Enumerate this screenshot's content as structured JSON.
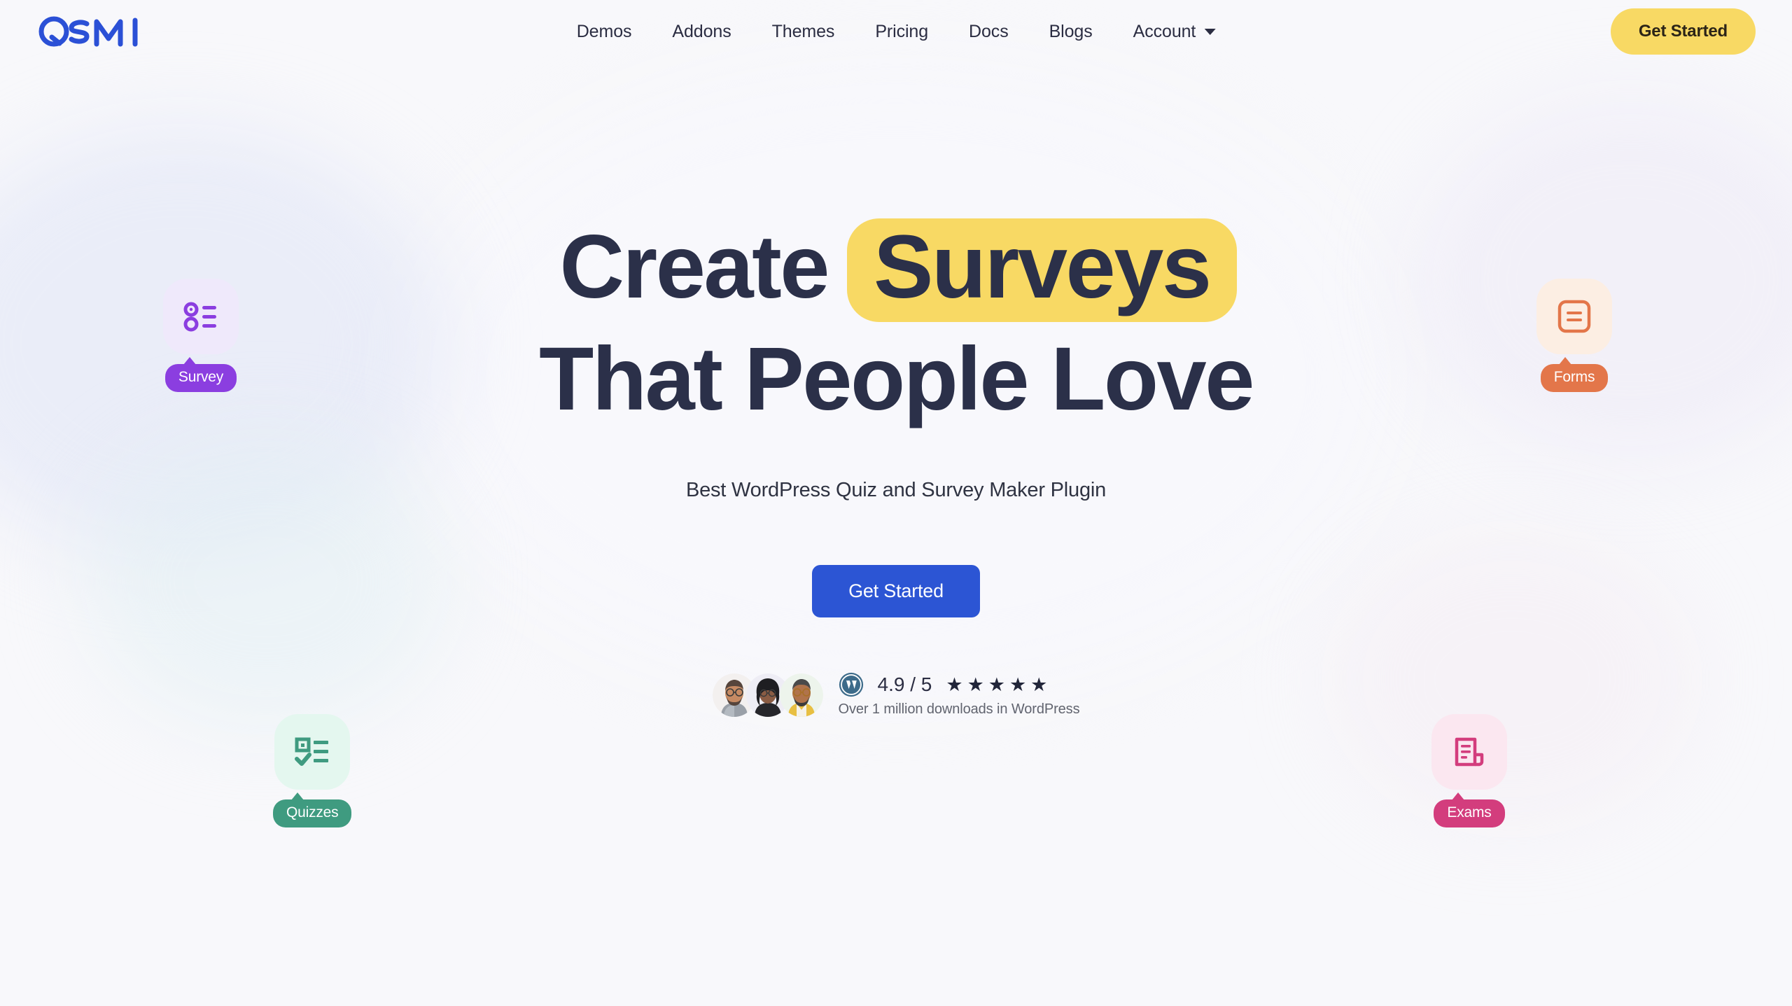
{
  "brand": {
    "name": "QSM",
    "logo_color": "#2b50d6"
  },
  "header": {
    "nav": [
      {
        "label": "Demos",
        "icon": null
      },
      {
        "label": "Addons",
        "icon": null
      },
      {
        "label": "Themes",
        "icon": null
      },
      {
        "label": "Pricing",
        "icon": null
      },
      {
        "label": "Docs",
        "icon": null
      },
      {
        "label": "Blogs",
        "icon": null
      },
      {
        "label": "Account",
        "icon": "chevron-down-icon"
      }
    ],
    "cta_label": "Get Started",
    "cta_bg": "#f8d964",
    "cta_text_color": "#2b2417"
  },
  "hero": {
    "title_part1": "Create",
    "title_highlight": "Surveys",
    "title_line2": "That People Love",
    "highlight_bg": "#f8d964",
    "title_color": "#2b3049",
    "subtitle": "Best WordPress Quiz and Survey Maker Plugin",
    "cta_label": "Get Started",
    "cta_bg": "#2c55d4",
    "cta_text_color": "#ffffff"
  },
  "social_proof": {
    "avatars": [
      {
        "name": "avatar-user-1",
        "bg": "#f3f0ef"
      },
      {
        "name": "avatar-user-2",
        "bg": "#eeedf5"
      },
      {
        "name": "avatar-user-3",
        "bg": "#edf4ec"
      }
    ],
    "platform_icon": "wordpress-icon",
    "rating_value": "4.9 / 5",
    "stars": "★★★★★",
    "star_count": 5,
    "downloads_text": "Over 1 million downloads in WordPress"
  },
  "feature_cards": [
    {
      "key": "survey",
      "label": "Survey",
      "icon": "survey-list-icon",
      "tile_bg": "#efe9fb",
      "icon_color": "#8b3ee0",
      "pill_bg": "#8b3ee0"
    },
    {
      "key": "quizzes",
      "label": "Quizzes",
      "icon": "quiz-checklist-icon",
      "tile_bg": "#e4f7ef",
      "icon_color": "#3f9b80",
      "pill_bg": "#3f9b80"
    },
    {
      "key": "forms",
      "label": "Forms",
      "icon": "form-document-icon",
      "tile_bg": "#fceee3",
      "icon_color": "#e3764a",
      "pill_bg": "#e3764a"
    },
    {
      "key": "exams",
      "label": "Exams",
      "icon": "exam-paper-icon",
      "tile_bg": "#fbe7f0",
      "icon_color": "#d33d7d",
      "pill_bg": "#d33d7d"
    }
  ]
}
